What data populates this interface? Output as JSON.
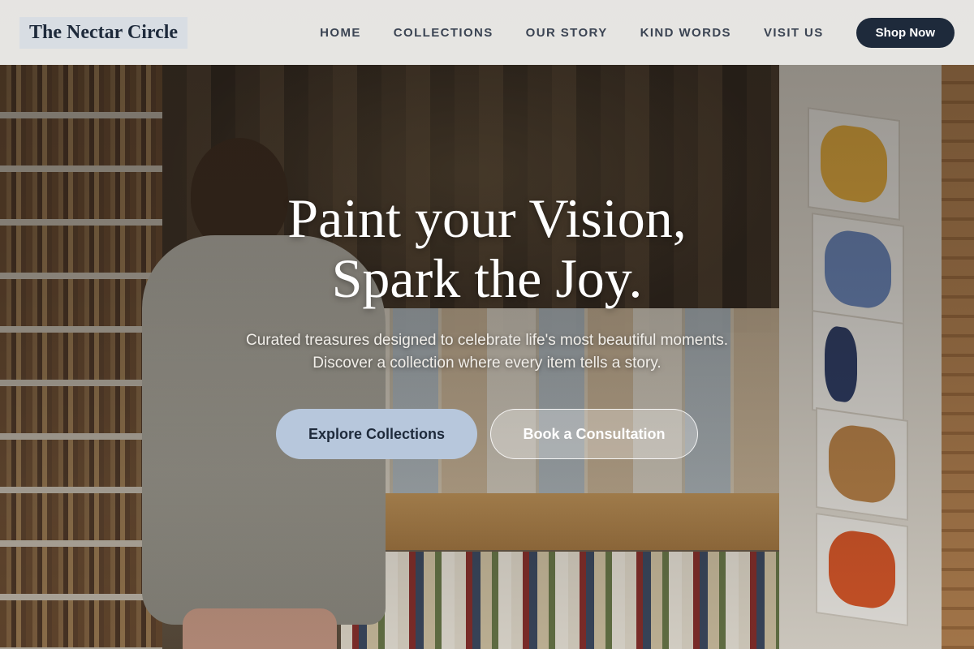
{
  "header": {
    "logo": "The Nectar Circle",
    "nav": [
      "HOME",
      "COLLECTIONS",
      "OUR STORY",
      "KIND WORDS",
      "VISIT US"
    ],
    "cta_label": "Shop Now"
  },
  "hero": {
    "title_line1": "Paint your Vision,",
    "title_line2": "Spark the Joy.",
    "subtitle_line1": "Curated treasures designed to celebrate life's most beautiful moments.",
    "subtitle_line2": "Discover a collection where every item tells a story.",
    "primary_cta": "Explore Collections",
    "secondary_cta": "Book a Consultation"
  },
  "colors": {
    "brand_navy": "#1e2a3b",
    "accent_blue": "#b7c7dc"
  }
}
